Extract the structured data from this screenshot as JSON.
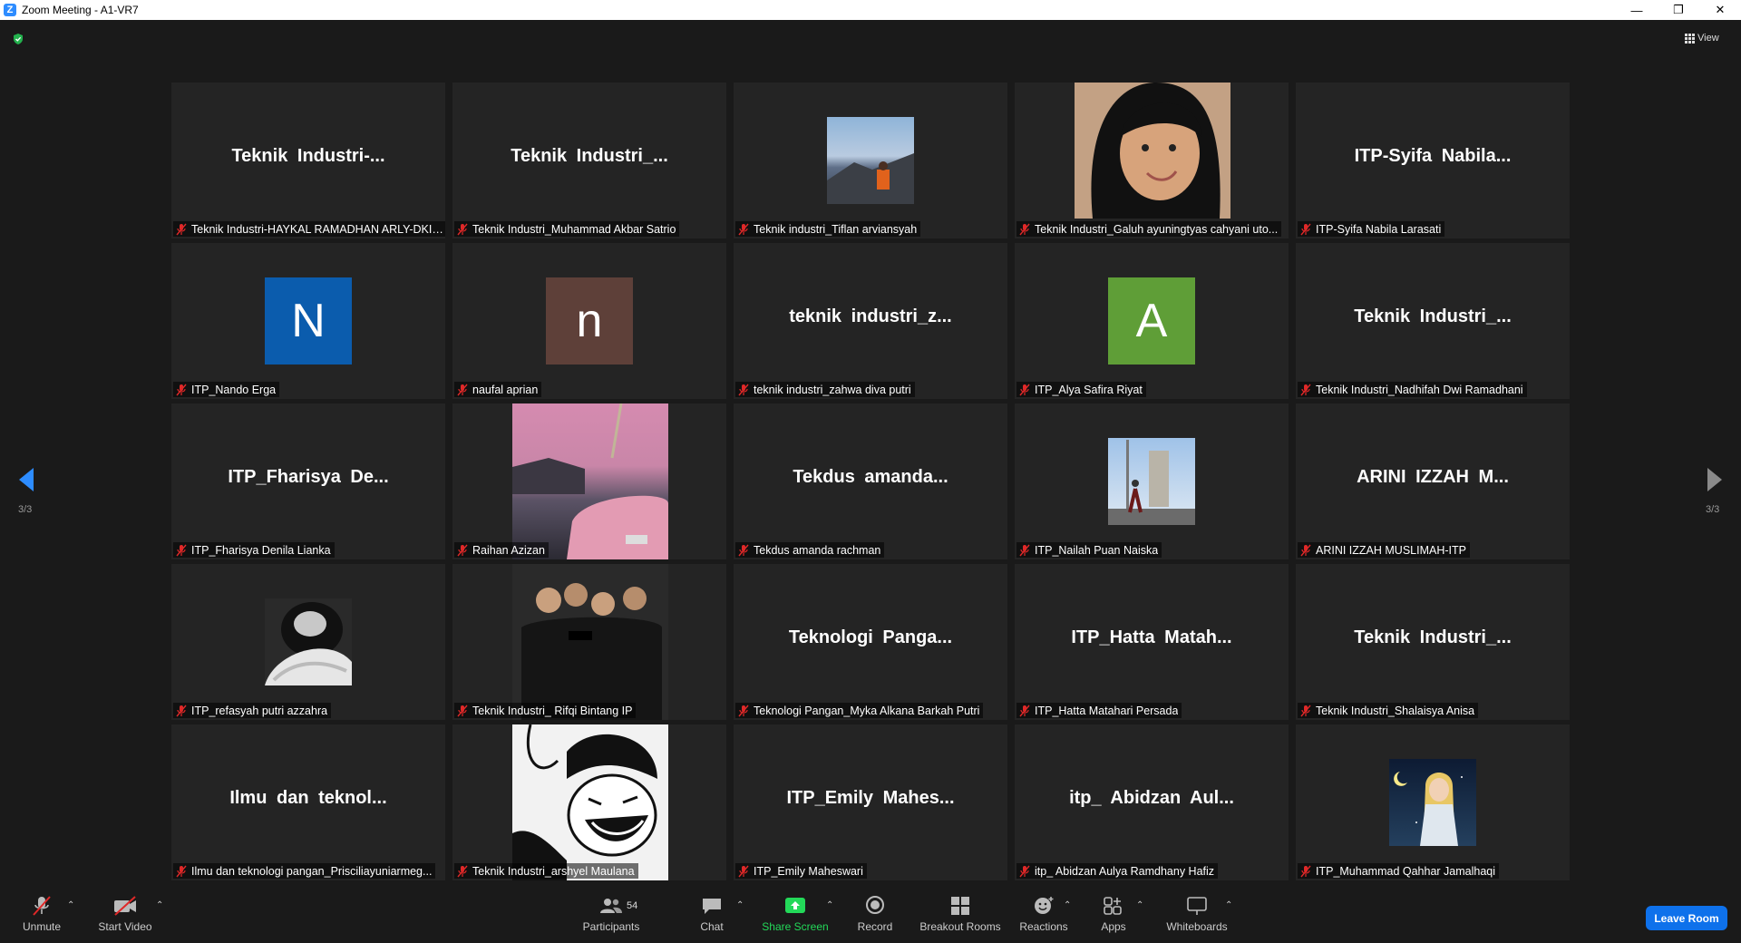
{
  "window": {
    "title": "Zoom Meeting - A1-VR7",
    "app_icon": "Z"
  },
  "top": {
    "view_label": "View"
  },
  "gallery": {
    "tiles": [
      {
        "big": "Teknik Industri-...",
        "label": "Teknik Industri-HAYKAL RAMADHAN ARLY-DKI ..."
      },
      {
        "big": "Teknik Industri_...",
        "label": "Teknik Industri_Muhammad Akbar Satrio"
      },
      {
        "big": "",
        "label": "Teknik industri_Tiflan arviansyah"
      },
      {
        "big": "",
        "label": "Teknik Industri_Galuh ayuningtyas cahyani uto..."
      },
      {
        "big": "ITP-Syifa Nabila...",
        "label": "ITP-Syifa Nabila Larasati"
      },
      {
        "big": "",
        "letter": "N",
        "label": "ITP_Nando Erga"
      },
      {
        "big": "",
        "letter": "n",
        "label": "naufal aprian"
      },
      {
        "big": "teknik industri_z...",
        "label": "teknik industri_zahwa diva putri"
      },
      {
        "big": "",
        "letter": "A",
        "label": "ITP_Alya Safira Riyat"
      },
      {
        "big": "Teknik Industri_...",
        "label": "Teknik Industri_Nadhifah Dwi Ramadhani"
      },
      {
        "big": "ITP_Fharisya De...",
        "label": "ITP_Fharisya Denila Lianka"
      },
      {
        "big": "",
        "label": "Raihan Azizan"
      },
      {
        "big": "Tekdus amanda...",
        "label": "Tekdus amanda rachman"
      },
      {
        "big": "",
        "label": "ITP_Nailah Puan Naiska"
      },
      {
        "big": "ARINI IZZAH M...",
        "label": "ARINI IZZAH MUSLIMAH-ITP"
      },
      {
        "big": "",
        "label": "ITP_refasyah putri azzahra"
      },
      {
        "big": "",
        "label": "Teknik Industri_ Rifqi Bintang IP"
      },
      {
        "big": "Teknologi Panga...",
        "label": "Teknologi Pangan_Myka Alkana Barkah Putri"
      },
      {
        "big": "ITP_Hatta Matah...",
        "label": "ITP_Hatta Matahari Persada"
      },
      {
        "big": "Teknik Industri_...",
        "label": "Teknik Industri_Shalaisya Anisa"
      },
      {
        "big": "Ilmu dan teknol...",
        "label": "Ilmu dan teknologi pangan_Prisciliayuniarmeg..."
      },
      {
        "big": "",
        "label": "Teknik Industri_arshyel Maulana"
      },
      {
        "big": "ITP_Emily Mahes...",
        "label": "ITP_Emily Maheswari"
      },
      {
        "big": "itp_ Abidzan Aul...",
        "label": "itp_ Abidzan Aulya Ramdhany Hafiz"
      },
      {
        "big": "",
        "label": "ITP_Muhammad Qahhar Jamalhaqi"
      }
    ],
    "avatar_colors": {
      "N": "#0b5cad",
      "n": "#5e4039",
      "A": "#5f9e37"
    }
  },
  "paging": {
    "left": "3/3",
    "right": "3/3"
  },
  "toolbar": {
    "unmute": "Unmute",
    "start_video": "Start Video",
    "participants": "Participants",
    "participants_count": "54",
    "chat": "Chat",
    "share_screen": "Share Screen",
    "record": "Record",
    "breakout_rooms": "Breakout Rooms",
    "reactions": "Reactions",
    "apps": "Apps",
    "whiteboards": "Whiteboards",
    "leave": "Leave Room"
  },
  "colors": {
    "accent_blue": "#0e71eb",
    "share_green": "#23d959",
    "muted_red": "#e02828"
  }
}
